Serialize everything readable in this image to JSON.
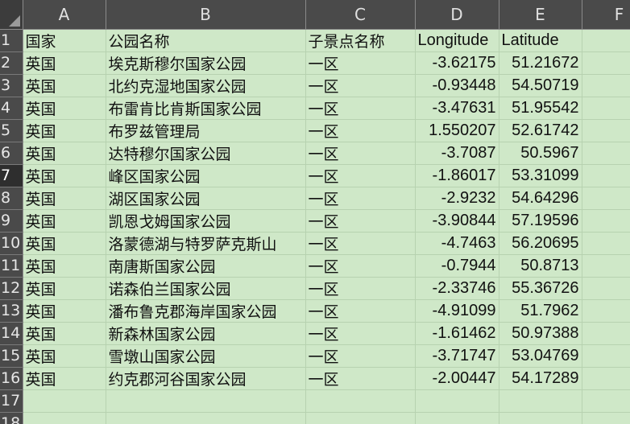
{
  "sheet": {
    "columns": [
      "A",
      "B",
      "C",
      "D",
      "E",
      "F"
    ],
    "rows": [
      {
        "num": "1",
        "cells": [
          "国家",
          "公园名称",
          "子景点名称",
          "Longitude",
          "Latitude",
          ""
        ]
      },
      {
        "num": "2",
        "cells": [
          "英国",
          "埃克斯穆尔国家公园",
          "一区",
          "-3.62175",
          "51.21672",
          ""
        ]
      },
      {
        "num": "3",
        "cells": [
          "英国",
          "北约克湿地国家公园",
          "一区",
          "-0.93448",
          "54.50719",
          ""
        ]
      },
      {
        "num": "4",
        "cells": [
          "英国",
          "布雷肯比肯斯国家公园",
          "一区",
          "-3.47631",
          "51.95542",
          ""
        ]
      },
      {
        "num": "5",
        "cells": [
          "英国",
          "布罗兹管理局",
          "一区",
          "1.550207",
          "52.61742",
          ""
        ]
      },
      {
        "num": "6",
        "cells": [
          "英国",
          "达特穆尔国家公园",
          "一区",
          "-3.7087",
          "50.5967",
          ""
        ]
      },
      {
        "num": "7",
        "cells": [
          "英国",
          "峰区国家公园",
          "一区",
          "-1.86017",
          "53.31099",
          ""
        ]
      },
      {
        "num": "8",
        "cells": [
          "英国",
          "湖区国家公园",
          "一区",
          "-2.9232",
          "54.64296",
          ""
        ]
      },
      {
        "num": "9",
        "cells": [
          "英国",
          "凯恩戈姆国家公园",
          "一区",
          "-3.90844",
          "57.19596",
          ""
        ]
      },
      {
        "num": "10",
        "cells": [
          "英国",
          "洛蒙德湖与特罗萨克斯山",
          "一区",
          "-4.7463",
          "56.20695",
          ""
        ]
      },
      {
        "num": "11",
        "cells": [
          "英国",
          "南唐斯国家公园",
          "一区",
          "-0.7944",
          "50.8713",
          ""
        ]
      },
      {
        "num": "12",
        "cells": [
          "英国",
          "诺森伯兰国家公园",
          "一区",
          "-2.33746",
          "55.36726",
          ""
        ]
      },
      {
        "num": "13",
        "cells": [
          "英国",
          "潘布鲁克郡海岸国家公园",
          "一区",
          "-4.91099",
          "51.7962",
          ""
        ]
      },
      {
        "num": "14",
        "cells": [
          "英国",
          "新森林国家公园",
          "一区",
          "-1.61462",
          "50.97388",
          ""
        ]
      },
      {
        "num": "15",
        "cells": [
          "英国",
          "雪墩山国家公园",
          "一区",
          "-3.71747",
          "53.04769",
          ""
        ]
      },
      {
        "num": "16",
        "cells": [
          "英国",
          "约克郡河谷国家公园",
          "一区",
          "-2.00447",
          "54.17289",
          ""
        ]
      },
      {
        "num": "17",
        "cells": [
          "",
          "",
          "",
          "",
          "",
          ""
        ]
      },
      {
        "num": "18",
        "cells": [
          "",
          "",
          "",
          "",
          "",
          ""
        ]
      }
    ],
    "selected_row": "7"
  },
  "colors": {
    "cell_background": "#cfe8c8",
    "header_background": "#4a4a4a",
    "header_text": "#e0e0e0"
  }
}
